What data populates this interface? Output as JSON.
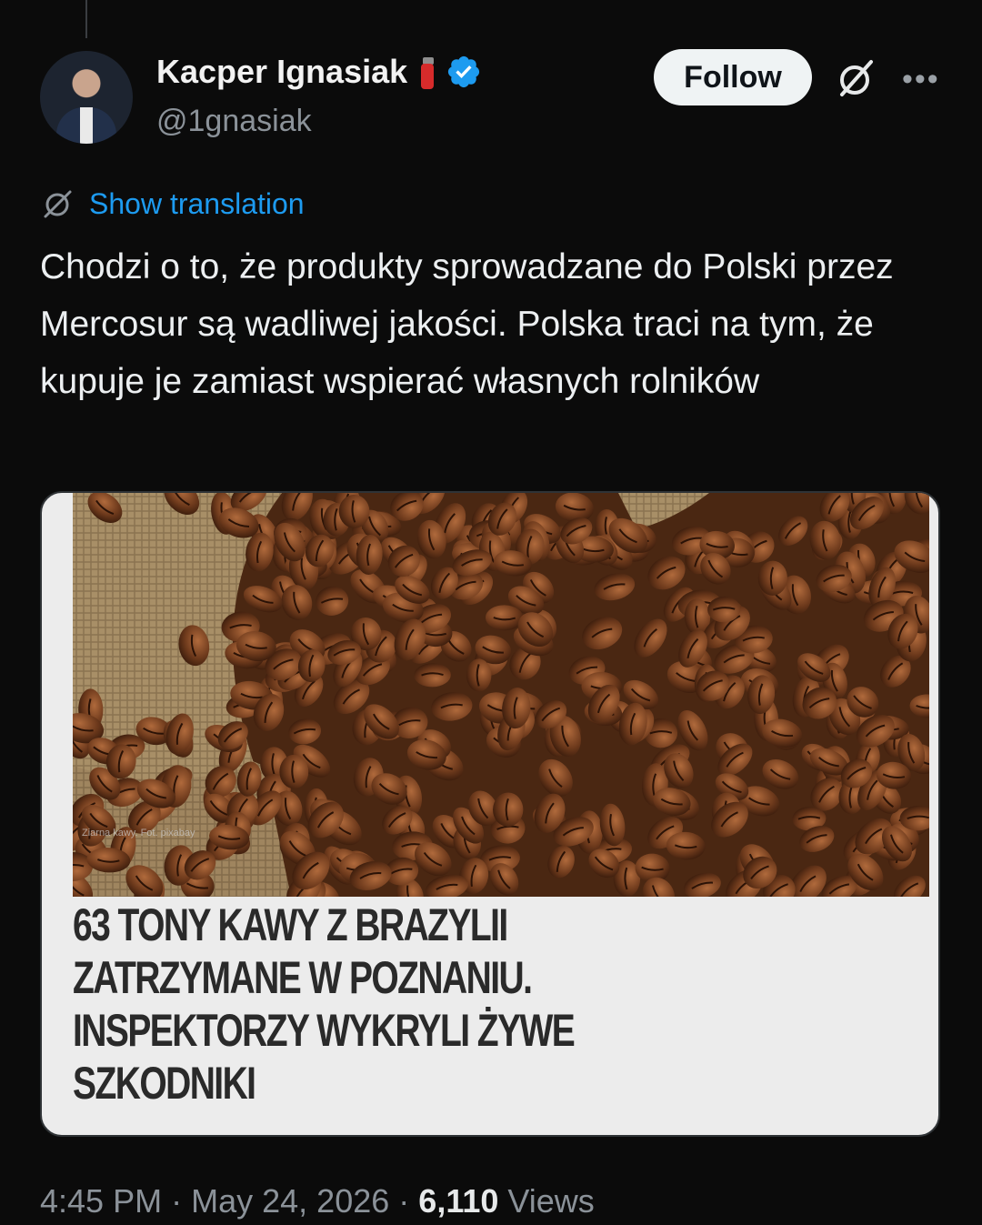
{
  "author": {
    "name": "Kacper Ignasiak",
    "handle": "@1gnasiak",
    "name_emoji": "fire-extinguisher-icon",
    "verified_color": "#1d9bf0"
  },
  "actions": {
    "follow_label": "Follow",
    "more_label": "•••"
  },
  "translation": {
    "label": "Show translation"
  },
  "tweet": {
    "text": "Chodzi o to, że produkty sprowadzane do Polski przez Mercosur są wadliwej jakości. Polska traci na tym, że kupuje je zamiast wspierać własnych rolników"
  },
  "card": {
    "photo_caption": "Ziarna kawy. Fot. pixabay",
    "headline_lines": [
      "63 TONY KAWY Z BRAZYLII",
      "ZATRZYMANE W POZNANIU.",
      "INSPEKTORZY WYKRYLI ŻYWE",
      "SZKODNIKI"
    ]
  },
  "meta": {
    "time": "4:45 PM",
    "separator": "·",
    "date": "May 24, 2026",
    "views_count": "6,110",
    "views_label": "Views"
  },
  "colors": {
    "background": "#0b0b0b",
    "accent": "#1d9bf0",
    "muted": "#8b9299"
  }
}
